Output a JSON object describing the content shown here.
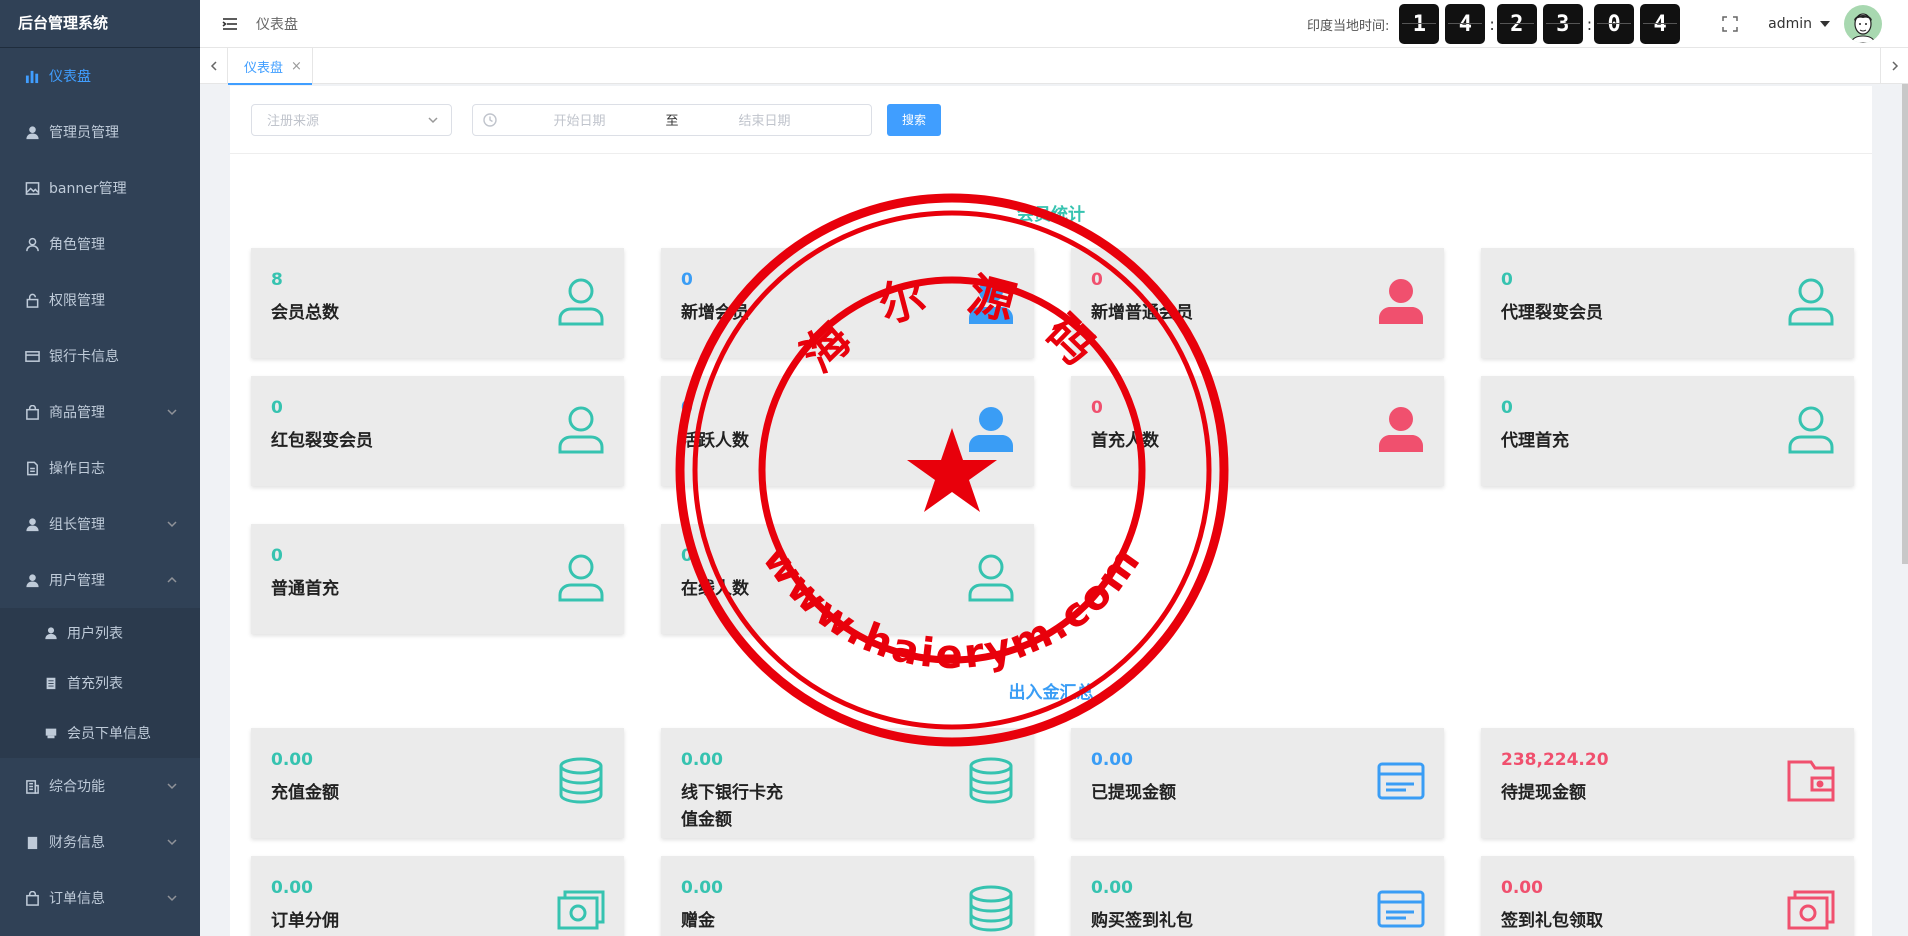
{
  "sidebar": {
    "title": "后台管理系统",
    "items": [
      {
        "label": "仪表盘",
        "active": true
      },
      {
        "label": "管理员管理"
      },
      {
        "label": "banner管理"
      },
      {
        "label": "角色管理"
      },
      {
        "label": "权限管理"
      },
      {
        "label": "银行卡信息"
      },
      {
        "label": "商品管理"
      },
      {
        "label": "操作日志"
      },
      {
        "label": "组长管理"
      },
      {
        "label": "用户管理"
      },
      {
        "label": "综合功能"
      },
      {
        "label": "财务信息"
      },
      {
        "label": "订单信息"
      }
    ],
    "subitems": [
      {
        "label": "用户列表"
      },
      {
        "label": "首充列表"
      },
      {
        "label": "会员下单信息"
      }
    ]
  },
  "topbar": {
    "breadcrumb": "仪表盘",
    "time_label": "印度当地时间:",
    "digits": [
      "1",
      "4",
      "2",
      "3",
      "0",
      "4"
    ],
    "colon": ":",
    "username": "admin"
  },
  "tabs": {
    "active_label": "仪表盘",
    "close": "×"
  },
  "filter": {
    "source_placeholder": "注册来源",
    "start_placeholder": "开始日期",
    "separator": "至",
    "end_placeholder": "结束日期",
    "search_label": "搜索"
  },
  "member_section": {
    "title": "会员统计",
    "cards": [
      {
        "value": "8",
        "label": "会员总数"
      },
      {
        "value": "0",
        "label": "新增会员"
      },
      {
        "value": "0",
        "label": "新增普通会员"
      },
      {
        "value": "0",
        "label": "代理裂变会员"
      },
      {
        "value": "0",
        "label": "红包裂变会员"
      },
      {
        "value": "0",
        "label": "活跃人数"
      },
      {
        "value": "0",
        "label": "首充人数"
      },
      {
        "value": "0",
        "label": "代理首充"
      },
      {
        "value": "0",
        "label": "普通首充"
      },
      {
        "value": "0",
        "label": "在线人数"
      }
    ]
  },
  "finance_section": {
    "title": "出入金汇总",
    "cards": [
      {
        "value": "0.00",
        "label": "充值金额"
      },
      {
        "value": "0.00",
        "label": "线下银行卡充\n值金额"
      },
      {
        "value": "0.00",
        "label": "已提现金额"
      },
      {
        "value": "238,224.20",
        "label": "待提现金额"
      },
      {
        "value": "0.00",
        "label": "订单分佣"
      },
      {
        "value": "0.00",
        "label": "赠金"
      },
      {
        "value": "0.00",
        "label": "购买签到礼包"
      },
      {
        "value": "0.00",
        "label": "签到礼包领取"
      }
    ]
  },
  "watermark": {
    "top_text": "海 尔 源 码",
    "bottom_text": "www.haierym.com"
  },
  "colors": {
    "sidebar_bg": "#304156",
    "accent": "#409eff",
    "teal": "#36c3b0",
    "blue": "#3a9df5",
    "red": "#f0506e",
    "seal_red": "#e8000b"
  }
}
